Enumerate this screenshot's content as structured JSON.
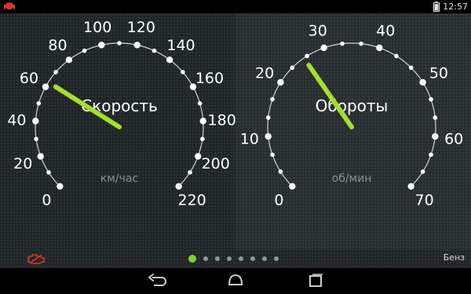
{
  "status_bar": {
    "time": "12:57",
    "icons": [
      "car-alert-icon",
      "battery-icon"
    ]
  },
  "speedometer": {
    "title": "Скорость",
    "unit": "км/час",
    "tick_labels": [
      "0",
      "20",
      "40",
      "60",
      "80",
      "100",
      "120",
      "140",
      "160",
      "180",
      "200",
      "220"
    ],
    "min": 0,
    "max": 220,
    "needle_value": 63
  },
  "tachometer": {
    "title": "Обороты",
    "unit": "об/мин",
    "tick_labels": [
      "0",
      "10",
      "20",
      "30",
      "40",
      "50",
      "60",
      "70"
    ],
    "min": 0,
    "max": 70,
    "needle_value": 26
  },
  "bottom_bar": {
    "fuel_label": "Бенз",
    "page_count": 8,
    "active_page": 0,
    "engine_icon": "engine-warning-icon"
  },
  "colors": {
    "needle": "#a4e02b",
    "warning": "#e03030",
    "active_dot": "#7ed321"
  },
  "nav_bar": {
    "icons": [
      "back-icon",
      "home-icon",
      "recent-apps-icon"
    ]
  }
}
